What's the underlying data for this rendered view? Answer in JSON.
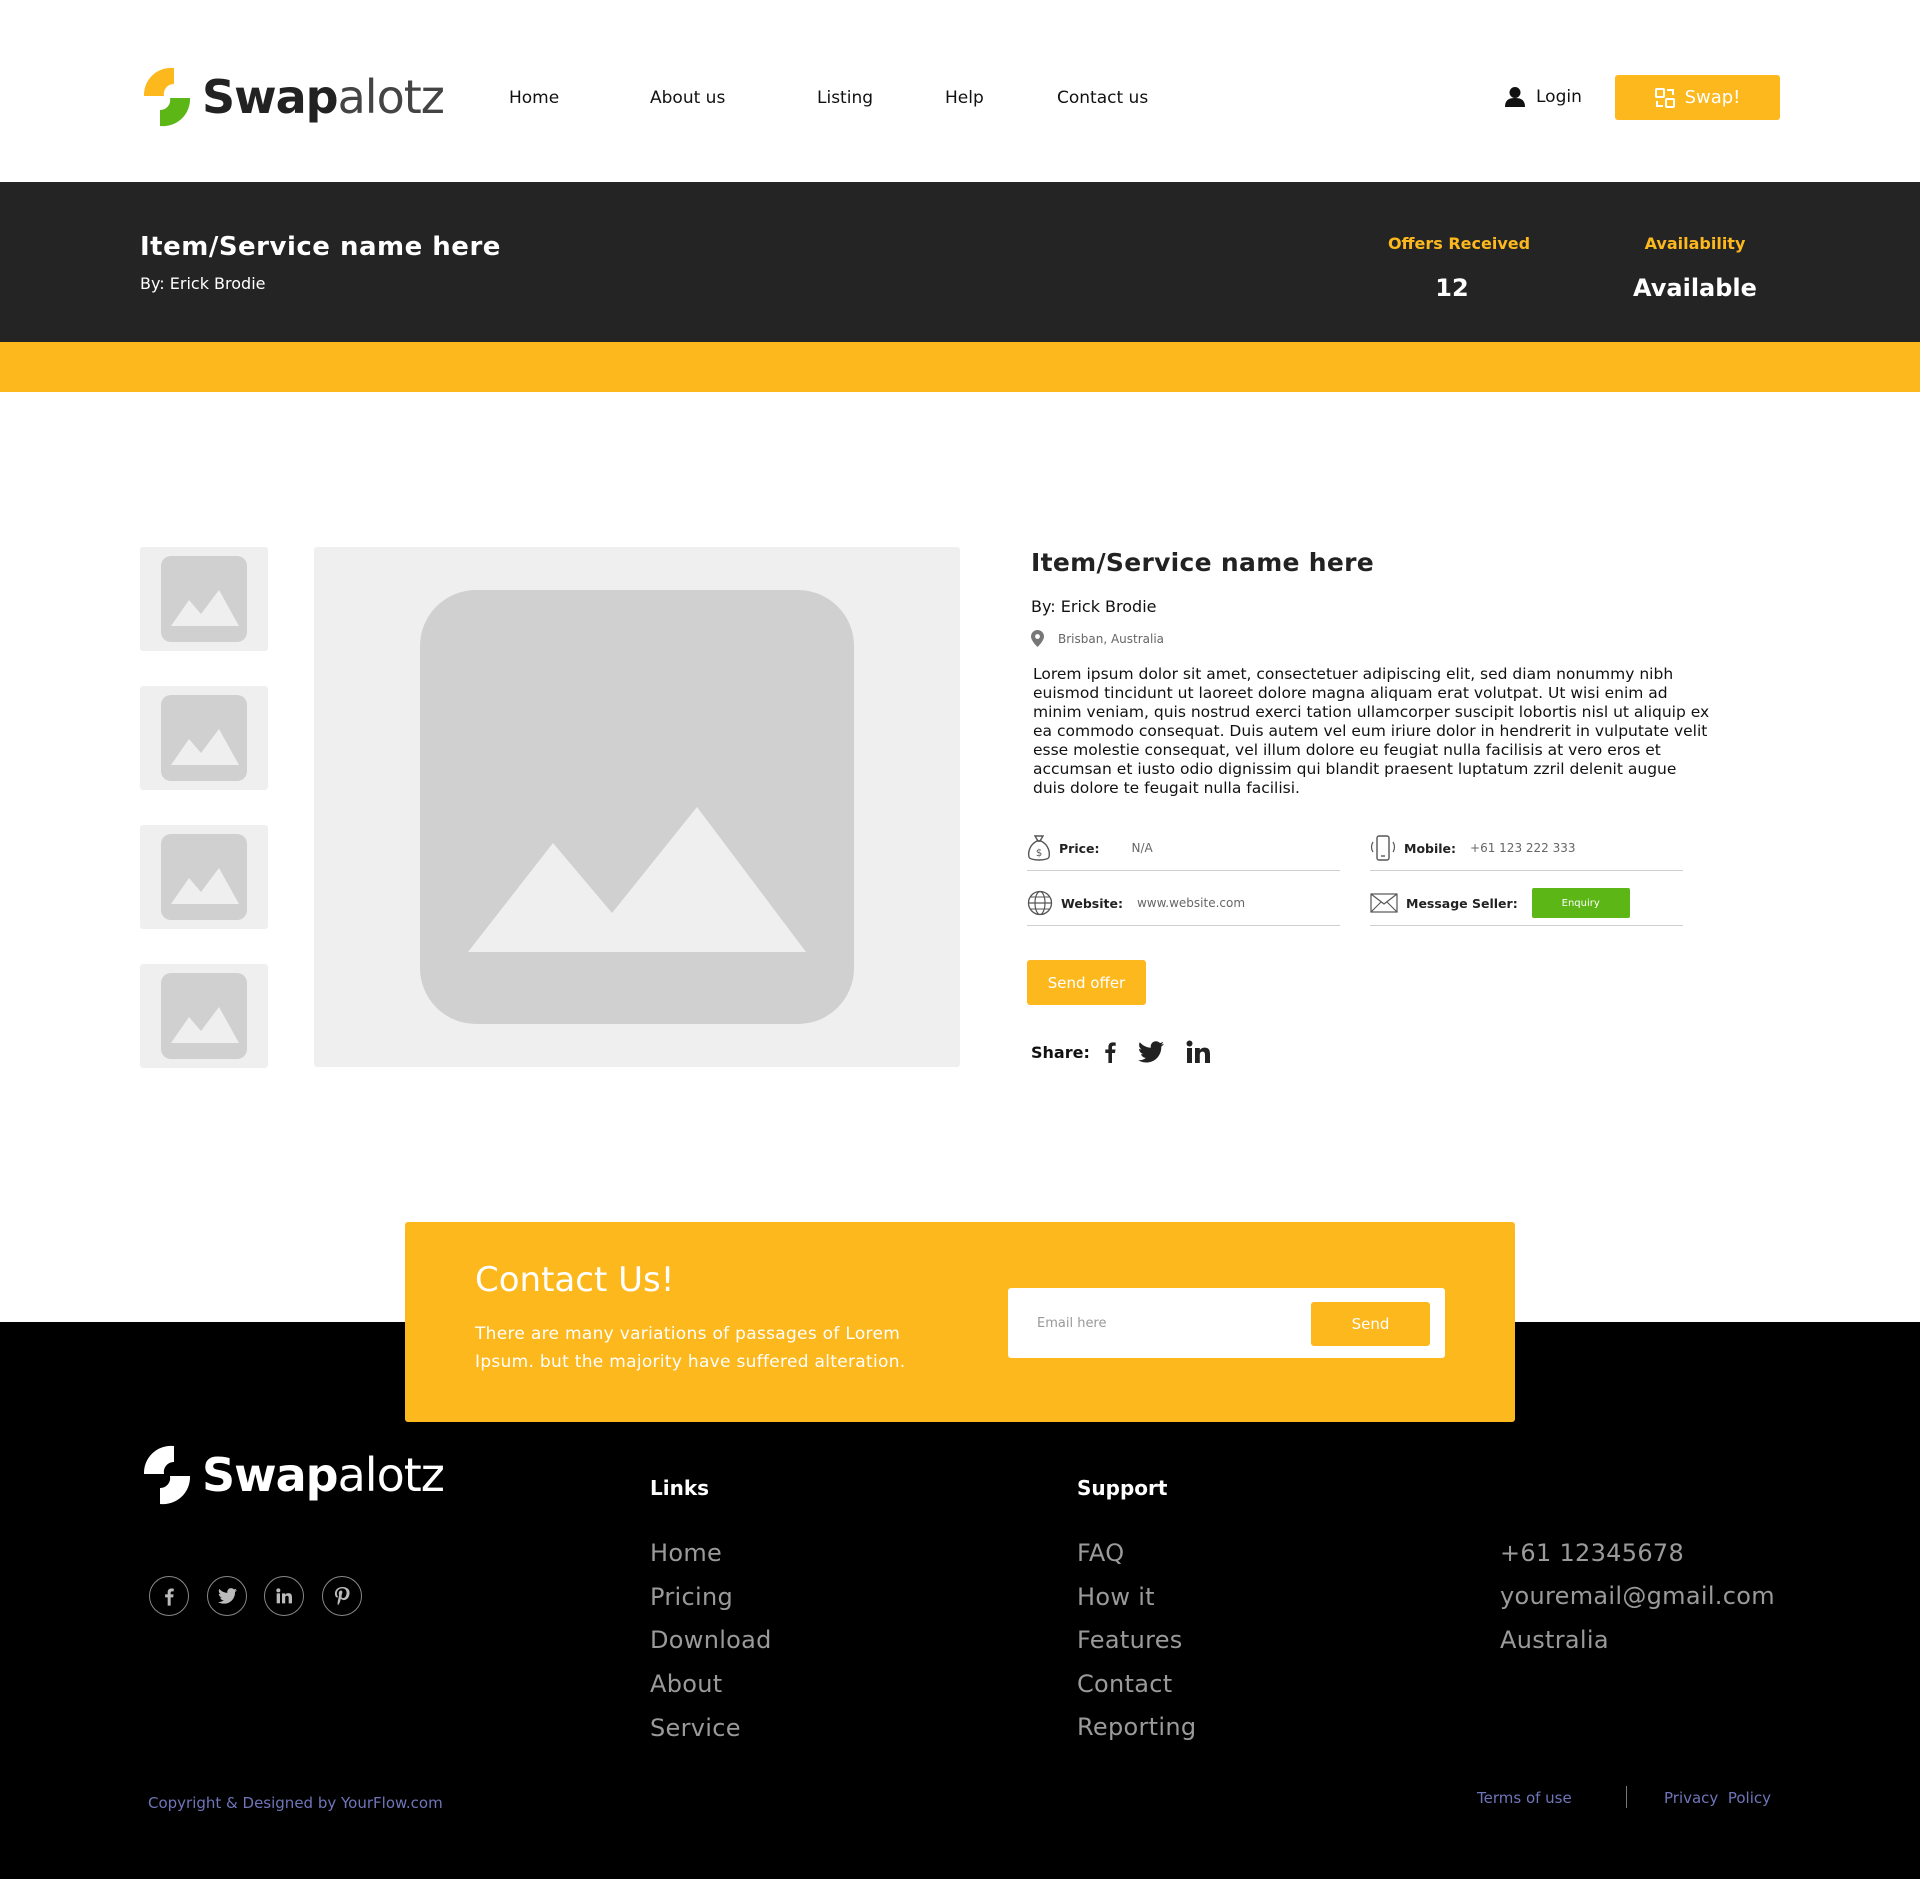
{
  "brand": {
    "name_bold": "Swap",
    "name_light": "alotz",
    "yellow": "#FDB81E",
    "green": "#5CB615",
    "dark": "#242424"
  },
  "nav": {
    "items": [
      "Home",
      "About us",
      "Listing",
      "Help",
      "Contact us"
    ],
    "login_label": "Login",
    "swap_label": "Swap!"
  },
  "banner": {
    "title": "Item/Service name here",
    "by": "By: Erick Brodie",
    "offers_label": "Offers Received",
    "offers_value": "12",
    "availability_label": "Availability",
    "availability_value": "Available"
  },
  "details": {
    "title": "Item/Service name here",
    "by": "By: Erick Brodie",
    "location": "Brisban, Australia",
    "description": "Lorem ipsum dolor sit amet, consectetuer adipiscing elit, sed diam nonummy nibh euismod tincidunt ut laoreet dolore magna aliquam erat volutpat. Ut wisi enim ad minim veniam, quis nostrud exerci tation ullamcorper suscipit lobortis nisl ut aliquip ex ea commodo consequat. Duis autem vel eum iriure dolor in hendrerit in vulputate velit esse molestie consequat, vel illum dolore eu feugiat nulla facilisis at vero eros et accumsan et iusto odio dignissim qui blandit praesent luptatum zzril delenit augue duis dolore te feugait nulla facilisi.",
    "price_label": "Price:",
    "price_value": "N/A",
    "mobile_label": "Mobile:",
    "mobile_value": "+61 123 222 333",
    "website_label": "Website:",
    "website_value": "www.website.com",
    "message_label": "Message Seller:",
    "enquiry_label": "Enquiry",
    "send_offer_label": "Send offer",
    "share_label": "Share:"
  },
  "contact": {
    "title": "Contact Us!",
    "text": "There are many variations of passages of Lorem Ipsum. but the majority have suffered alteration.",
    "email_placeholder": "Email here",
    "send_label": "Send"
  },
  "footer": {
    "links_heading": "Links",
    "links": [
      "Home",
      "Pricing",
      "Download",
      "About",
      "Service"
    ],
    "support_heading": "Support",
    "support": [
      "FAQ",
      "How it",
      "Features",
      "Contact",
      "Reporting"
    ],
    "phone": "+61 12345678",
    "email": "youremail@gmail.com",
    "country": "Australia",
    "copyright": "Copyright & Designed by YourFlow.com",
    "terms": "Terms of use",
    "privacy": "Privacy  Policy"
  }
}
